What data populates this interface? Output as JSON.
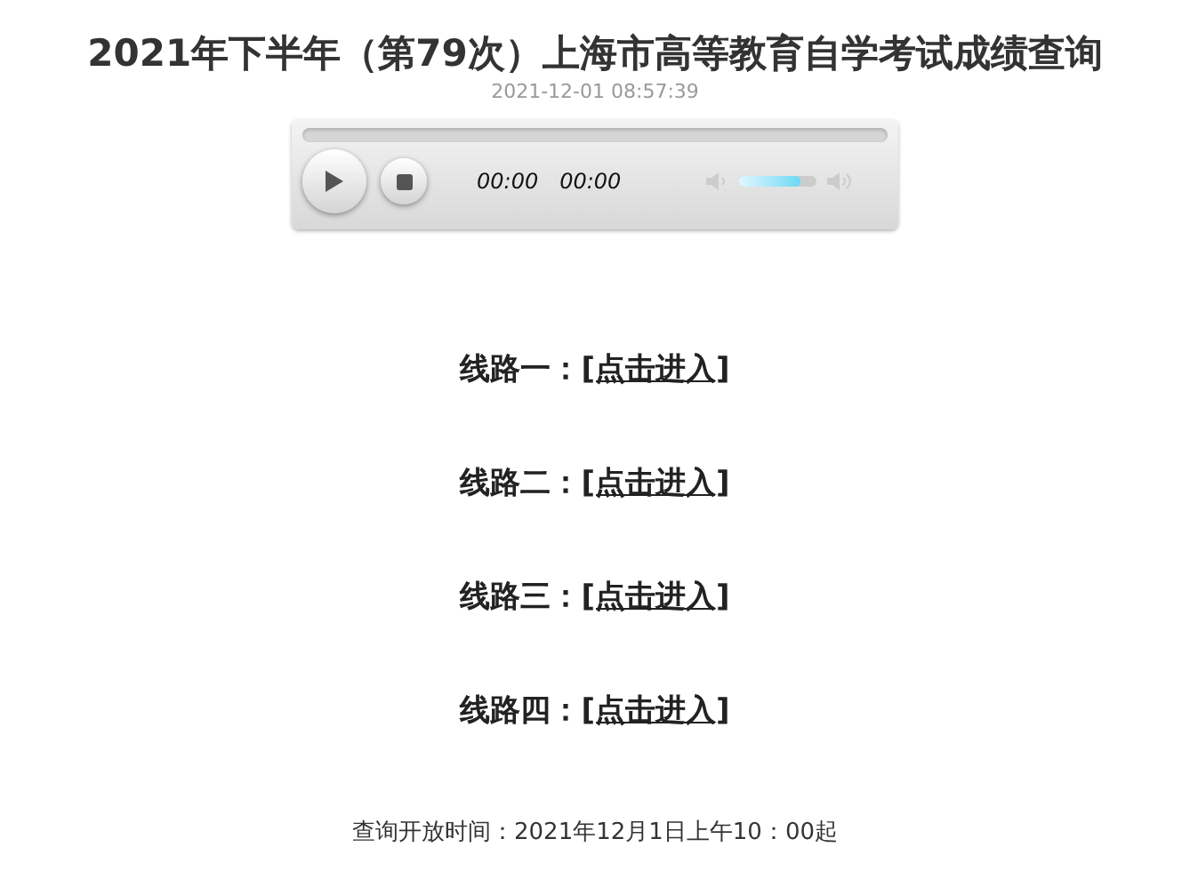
{
  "title": "2021年下半年（第79次）上海市高等教育自学考试成绩查询",
  "date": "2021-12-01 08:57:39",
  "player": {
    "current_time": "00:00",
    "duration": "00:00",
    "volume": {
      "level": 0.8
    }
  },
  "routes": [
    {
      "label": "线路一：",
      "link": "[点击进入]"
    },
    {
      "label": "线路二：",
      "link": "[点击进入]"
    },
    {
      "label": "线路三：",
      "link": "[点击进入]"
    },
    {
      "label": "线路四：",
      "link": "[点击进入]"
    }
  ],
  "footer": "查询开放时间：2021年12月1日上午10：00起"
}
